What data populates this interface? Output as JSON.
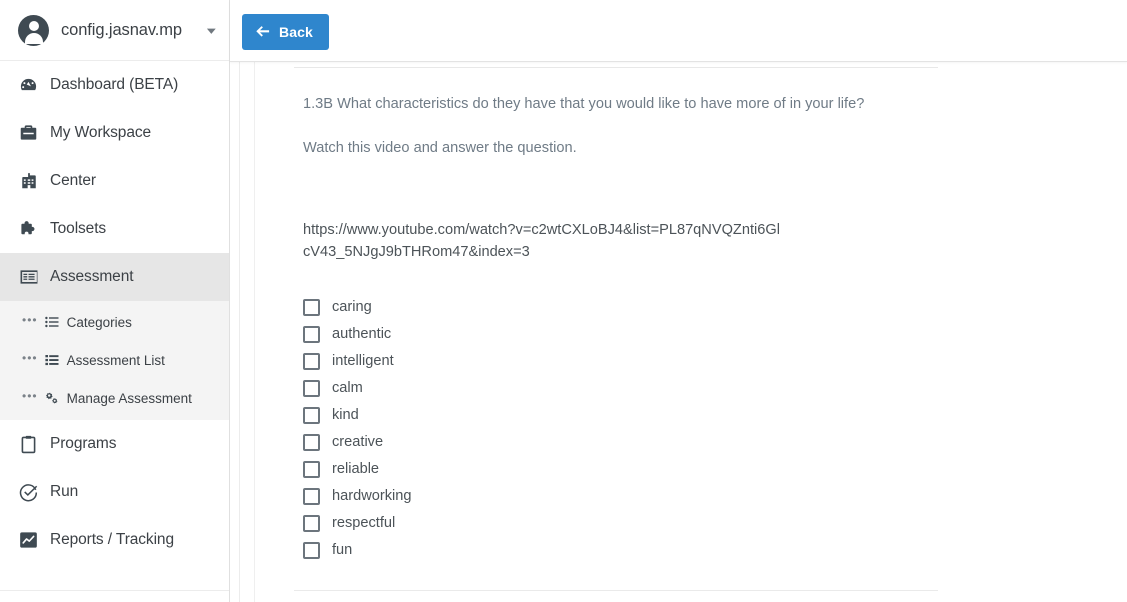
{
  "sidebar": {
    "user": {
      "name": "config.jasnav.mp",
      "avatar_icon": "user-avatar-icon",
      "caret_icon": "chevron-down-icon"
    },
    "items": [
      {
        "label": "Dashboard (BETA)",
        "icon": "dashboard-gauge-icon",
        "active": false
      },
      {
        "label": "My Workspace",
        "icon": "briefcase-icon",
        "active": false
      },
      {
        "label": "Center",
        "icon": "building-icon",
        "active": false
      },
      {
        "label": "Toolsets",
        "icon": "puzzle-piece-icon",
        "active": false
      },
      {
        "label": "Assessment",
        "icon": "assessment-list-icon",
        "active": true
      },
      {
        "label": "Programs",
        "icon": "clipboard-icon",
        "active": false
      },
      {
        "label": "Run",
        "icon": "check-circle-icon",
        "active": false
      },
      {
        "label": "Reports / Tracking",
        "icon": "chart-line-icon",
        "active": false
      }
    ],
    "submenu": [
      {
        "label": "Categories",
        "icon": "list-icon",
        "dots": "•••"
      },
      {
        "label": "Assessment List",
        "icon": "list-detail-icon",
        "dots": "•••"
      },
      {
        "label": "Manage Assessment",
        "icon": "gears-icon",
        "dots": "•••"
      }
    ]
  },
  "topbar": {
    "back_label": "Back",
    "back_icon": "arrow-left-icon",
    "back_color": "#2f86cd"
  },
  "question": {
    "title": "1.3B What characteristics do they have that you would like to have more of in your life?",
    "instruction": "Watch this video and answer the question.",
    "url_line1": "https://www.youtube.com/watch?",
    "url_line2": "v=c2wtCXLoBJ4&list=PL87qNVQZnti6GlcV43_5NJgJ9bTHRom47&index=3",
    "options": [
      {
        "label": "caring",
        "checked": false
      },
      {
        "label": "authentic",
        "checked": false
      },
      {
        "label": "intelligent",
        "checked": false
      },
      {
        "label": "calm",
        "checked": false
      },
      {
        "label": "kind",
        "checked": false
      },
      {
        "label": "creative",
        "checked": false
      },
      {
        "label": "reliable",
        "checked": false
      },
      {
        "label": "hardworking",
        "checked": false
      },
      {
        "label": "respectful",
        "checked": false
      },
      {
        "label": "fun",
        "checked": false
      }
    ]
  },
  "colors": {
    "accent": "#2f86cd",
    "text_muted": "#6f7b86",
    "text_primary": "#4c5358",
    "sidebar_active_bg": "#e6e6e6",
    "submenu_bg": "#f4f4f4"
  }
}
